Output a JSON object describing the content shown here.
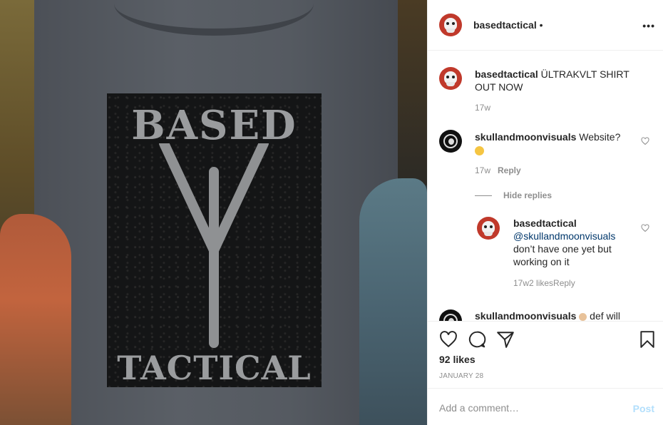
{
  "photo": {
    "shirt_text_top": "BASED",
    "shirt_text_bottom": "TACTICAL"
  },
  "header": {
    "username": "basedtactical",
    "dot": " •",
    "more": "•••"
  },
  "caption": {
    "username": "basedtactical",
    "text": " ÜLTRAKVLT SHIRT OUT NOW",
    "time": "17w"
  },
  "comments": [
    {
      "username": "skullandmoonvisuals",
      "text": " Website?",
      "time": "17w",
      "reply_label": "Reply"
    }
  ],
  "hide_replies": "Hide replies",
  "reply": {
    "username": "basedtactical",
    "mention": "@skullandmoonvisuals",
    "text": " don’t have one yet but working on it",
    "time": "17w",
    "likes": "2 likes",
    "reply_label": "Reply"
  },
  "partial_comment": {
    "username": "skullandmoonvisuals",
    "text": " def will"
  },
  "actions": {
    "likes": "92 likes",
    "date": "JANUARY 28"
  },
  "add_comment": {
    "placeholder": "Add a comment…",
    "post_label": "Post"
  },
  "colors": {
    "avatar_red": "#c0392b",
    "link": "#00376b",
    "muted": "#8e8e8e",
    "post_disabled": "#b2dffc"
  }
}
